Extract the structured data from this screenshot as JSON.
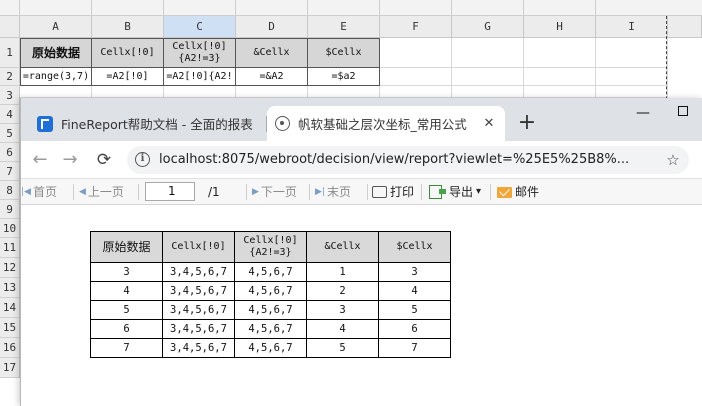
{
  "designer": {
    "columns": [
      "A",
      "B",
      "C",
      "D",
      "E",
      "F",
      "G",
      "H",
      "I"
    ],
    "rows": [
      "1",
      "2",
      "3",
      "4",
      "5",
      "6",
      "7",
      "8",
      "9",
      "10",
      "11",
      "12",
      "13",
      "14",
      "15",
      "16",
      "17"
    ],
    "header_cells": {
      "a1": "原始数据",
      "b1": "Cellx[!0]",
      "c1": "Cellx[!0]{A2!=3}",
      "d1": "&Cellx",
      "e1": "$Cellx"
    },
    "formula_cells": {
      "a2": "=range(3,7)",
      "b2": "=A2[!0]",
      "c2": "=A2[!0]{A2!",
      "d2": "=&A2",
      "e2": "=$a2"
    },
    "selected_column": "C"
  },
  "browser": {
    "tabs": [
      {
        "title": "FineReport帮助文档 - 全面的报表",
        "favicon": "finereport-icon",
        "active": false
      },
      {
        "title": "帆软基础之层次坐标_常用公式",
        "favicon": "globe-icon",
        "active": true
      }
    ],
    "new_tab": "+",
    "window_controls": {
      "minimize": "—",
      "maximize": "□"
    },
    "address": {
      "url": "localhost:8075/webroot/decision/view/report?viewlet=%25E5%25B8%...",
      "info_icon": "i"
    },
    "nav": {
      "back": "←",
      "forward": "→",
      "reload": "C",
      "bookmark": "☆"
    }
  },
  "report_toolbar": {
    "first_page": "首页",
    "prev_page": "上一页",
    "current_page": "1",
    "total_pages": "/1",
    "next_page": "下一页",
    "last_page": "末页",
    "print": "打印",
    "export": "导出",
    "export_caret": "▾",
    "email": "邮件"
  },
  "report_table": {
    "headers": [
      "原始数据",
      "Cellx[!0]",
      "Cellx[!0]\n{A2!=3}",
      "&Cellx",
      "$Cellx"
    ],
    "rows": [
      [
        "3",
        "3,4,5,6,7",
        "4,5,6,7",
        "1",
        "3"
      ],
      [
        "4",
        "3,4,5,6,7",
        "4,5,6,7",
        "2",
        "4"
      ],
      [
        "5",
        "3,4,5,6,7",
        "4,5,6,7",
        "3",
        "5"
      ],
      [
        "6",
        "3,4,5,6,7",
        "4,5,6,7",
        "4",
        "6"
      ],
      [
        "7",
        "3,4,5,6,7",
        "4,5,6,7",
        "5",
        "7"
      ]
    ]
  }
}
